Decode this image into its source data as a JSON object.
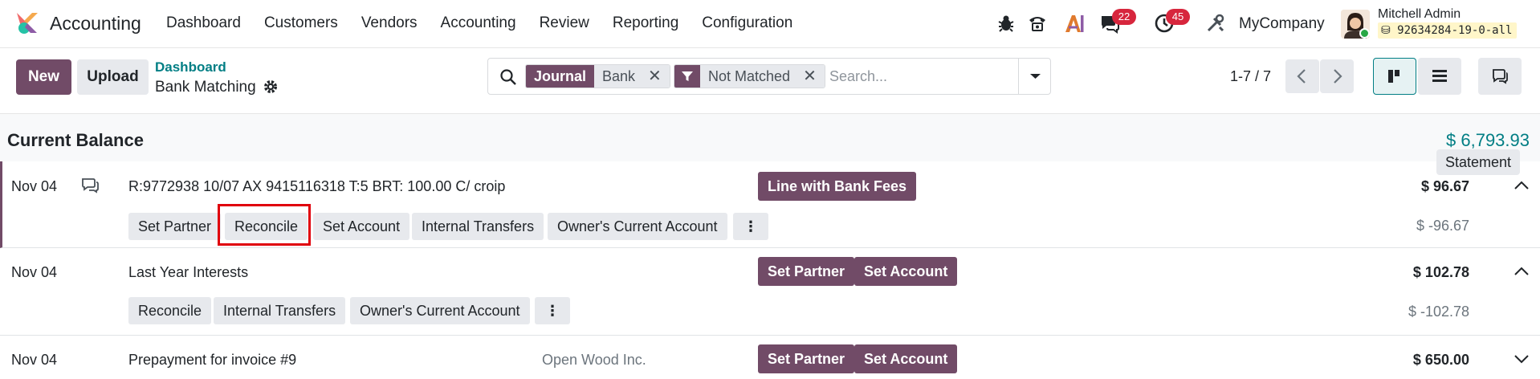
{
  "app": {
    "name": "Accounting"
  },
  "menu": [
    {
      "label": "Dashboard"
    },
    {
      "label": "Customers"
    },
    {
      "label": "Vendors"
    },
    {
      "label": "Accounting"
    },
    {
      "label": "Review"
    },
    {
      "label": "Reporting"
    },
    {
      "label": "Configuration"
    }
  ],
  "systray": {
    "messages_count": "22",
    "activities_count": "45",
    "company": "MyCompany",
    "user_name": "Mitchell Admin",
    "database": "92634284-19-0-all",
    "icons": [
      "bug-icon",
      "phone-icon",
      "ai-icon",
      "chat-icon",
      "clock-icon",
      "tools-icon"
    ]
  },
  "control_panel": {
    "new_label": "New",
    "upload_label": "Upload",
    "breadcrumb_parent": "Dashboard",
    "breadcrumb_current": "Bank Matching",
    "search": {
      "facets": [
        {
          "category": "Journal",
          "value": "Bank",
          "kind": "field"
        },
        {
          "category": "",
          "value": "Not Matched",
          "kind": "filter"
        }
      ],
      "placeholder": "Search..."
    },
    "pager": "1-7 / 7",
    "active_view": "kanban"
  },
  "balance": {
    "title": "Current Balance",
    "amount": "$ 6,793.93",
    "statement_label": "Statement"
  },
  "lines": [
    {
      "date": "Nov 04",
      "label": "R:9772938 10/07 AX 9415116318 T:5 BRT: 100.00 C/ croip",
      "partner": "",
      "amount": "$ 96.67",
      "residual": "$ -96.67",
      "expanded": true,
      "primary_buttons": [
        "Line with Bank Fees"
      ],
      "secondary_buttons": [
        "Set Partner",
        "Reconcile",
        "Set Account",
        "Internal Transfers",
        "Owner's Current Account"
      ]
    },
    {
      "date": "Nov 04",
      "label": "Last Year Interests",
      "partner": "",
      "amount": "$ 102.78",
      "residual": "$ -102.78",
      "expanded": true,
      "primary_buttons": [
        "Set Partner",
        "Set Account"
      ],
      "secondary_buttons": [
        "Reconcile",
        "Internal Transfers",
        "Owner's Current Account"
      ]
    },
    {
      "date": "Nov 04",
      "label": "Prepayment for invoice #9",
      "partner": "Open Wood Inc.",
      "amount": "$ 650.00",
      "residual": "",
      "expanded": false,
      "primary_buttons": [
        "Set Partner",
        "Set Account"
      ],
      "secondary_buttons": []
    }
  ],
  "kebab_label": "⋮",
  "colors": {
    "brand": "#714b67",
    "link": "#017e84",
    "badge": "#d7263d",
    "highlight": "#e0000b"
  }
}
